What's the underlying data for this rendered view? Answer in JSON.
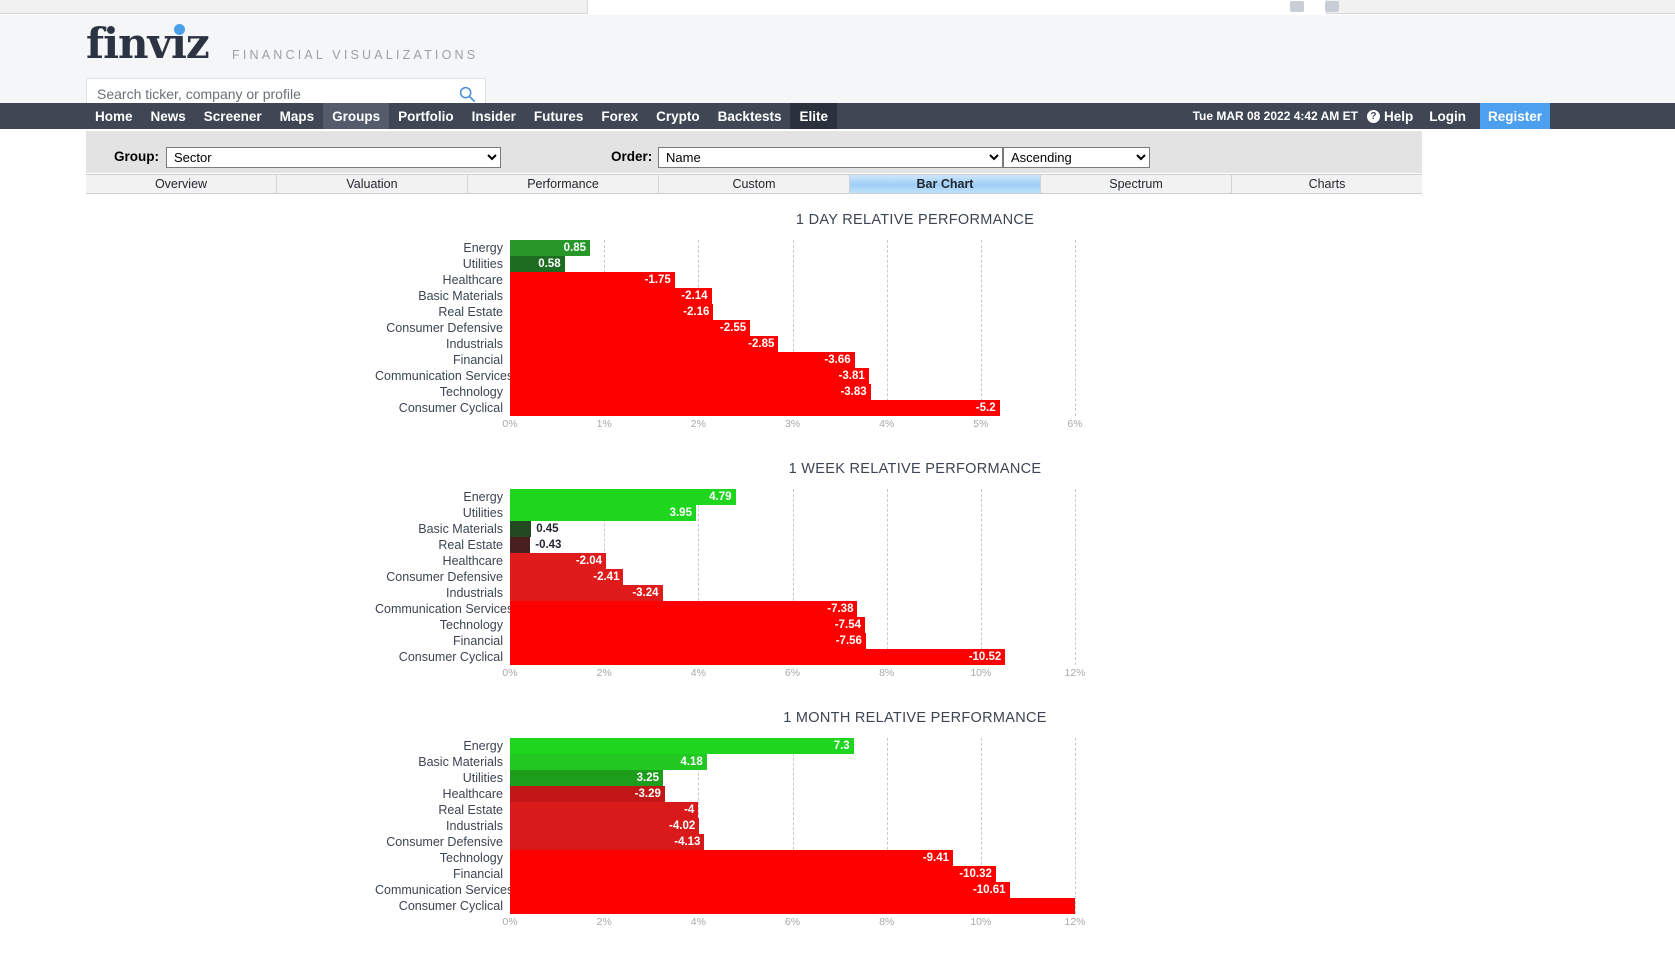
{
  "header": {
    "logo_text": "finviz",
    "tagline": "FINANCIAL VISUALIZATIONS",
    "search_placeholder": "Search ticker, company or profile",
    "search_value": "",
    "search_icon": "search-icon"
  },
  "nav": {
    "items": [
      {
        "label": "Home",
        "state": "normal"
      },
      {
        "label": "News",
        "state": "normal"
      },
      {
        "label": "Screener",
        "state": "normal"
      },
      {
        "label": "Maps",
        "state": "normal"
      },
      {
        "label": "Groups",
        "state": "active"
      },
      {
        "label": "Portfolio",
        "state": "normal"
      },
      {
        "label": "Insider",
        "state": "normal"
      },
      {
        "label": "Futures",
        "state": "normal"
      },
      {
        "label": "Forex",
        "state": "normal"
      },
      {
        "label": "Crypto",
        "state": "normal"
      },
      {
        "label": "Backtests",
        "state": "normal"
      },
      {
        "label": "Elite",
        "state": "elite"
      }
    ],
    "datetime": "Tue MAR 08 2022 4:42 AM ET",
    "help_icon": "question-mark-icon",
    "help_label": "Help",
    "login_label": "Login",
    "register_label": "Register",
    "register_color": "#4da0f0"
  },
  "controls": {
    "group_label": "Group:",
    "group_value": "Sector",
    "order_label": "Order:",
    "order_value": "Name",
    "direction_value": "Ascending"
  },
  "tabs": [
    {
      "label": "Overview",
      "active": false
    },
    {
      "label": "Valuation",
      "active": false
    },
    {
      "label": "Performance",
      "active": false
    },
    {
      "label": "Custom",
      "active": false
    },
    {
      "label": "Bar Chart",
      "active": true
    },
    {
      "label": "Spectrum",
      "active": false
    },
    {
      "label": "Charts",
      "active": false
    }
  ],
  "chart_data": [
    {
      "type": "bar",
      "orientation": "horizontal",
      "title": "1 DAY RELATIVE PERFORMANCE",
      "xlabel": "",
      "ylabel": "",
      "xlim": [
        0,
        6
      ],
      "ticks": [
        "0%",
        "1%",
        "2%",
        "3%",
        "4%",
        "5%",
        "6%"
      ],
      "grid": true,
      "categories": [
        "Energy",
        "Utilities",
        "Healthcare",
        "Basic Materials",
        "Real Estate",
        "Consumer Defensive",
        "Industrials",
        "Financial",
        "Communication Services",
        "Technology",
        "Consumer Cyclical"
      ],
      "values": [
        0.85,
        0.58,
        -1.75,
        -2.14,
        -2.16,
        -2.55,
        -2.85,
        -3.66,
        -3.81,
        -3.83,
        -5.2
      ],
      "labels": [
        "0.85",
        "0.58",
        "-1.75",
        "-2.14",
        "-2.16",
        "-2.55",
        "-2.85",
        "-3.66",
        "-3.81",
        "-3.83",
        "-5.2"
      ],
      "colors": [
        "#27972a",
        "#1e6b22",
        "#ff0000",
        "#ff0000",
        "#ff0000",
        "#ff0000",
        "#ff0000",
        "#ff0000",
        "#ff0000",
        "#ff0000",
        "#ff0000"
      ]
    },
    {
      "type": "bar",
      "orientation": "horizontal",
      "title": "1 WEEK RELATIVE PERFORMANCE",
      "xlabel": "",
      "ylabel": "",
      "xlim": [
        0,
        12
      ],
      "ticks": [
        "0%",
        "2%",
        "4%",
        "6%",
        "8%",
        "10%",
        "12%"
      ],
      "grid": true,
      "categories": [
        "Energy",
        "Utilities",
        "Basic Materials",
        "Real Estate",
        "Healthcare",
        "Consumer Defensive",
        "Industrials",
        "Communication Services",
        "Technology",
        "Financial",
        "Consumer Cyclical"
      ],
      "values": [
        4.79,
        3.95,
        0.45,
        -0.43,
        -2.04,
        -2.41,
        -3.24,
        -7.38,
        -7.54,
        -7.56,
        -10.52
      ],
      "labels": [
        "4.79",
        "3.95",
        "0.45",
        "-0.43",
        "-2.04",
        "-2.41",
        "-3.24",
        "-7.38",
        "-7.54",
        "-7.56",
        "-10.52"
      ],
      "colors": [
        "#1fd61f",
        "#1fd61f",
        "#224a22",
        "#4a1f1f",
        "#e01b1b",
        "#e01b1b",
        "#e01b1b",
        "#ff0000",
        "#ff0000",
        "#ff0000",
        "#ff0000"
      ]
    },
    {
      "type": "bar",
      "orientation": "horizontal",
      "title": "1 MONTH RELATIVE PERFORMANCE",
      "xlabel": "",
      "ylabel": "",
      "xlim": [
        0,
        12
      ],
      "ticks": [
        "0%",
        "2%",
        "4%",
        "6%",
        "8%",
        "10%",
        "12%"
      ],
      "grid": true,
      "categories": [
        "Energy",
        "Basic Materials",
        "Utilities",
        "Healthcare",
        "Real Estate",
        "Industrials",
        "Consumer Defensive",
        "Technology",
        "Financial",
        "Communication Services",
        "Consumer Cyclical"
      ],
      "values": [
        7.3,
        4.18,
        3.25,
        -3.29,
        -4,
        -4.02,
        -4.13,
        -9.41,
        -10.32,
        -10.61,
        -12.5
      ],
      "labels": [
        "7.3",
        "4.18",
        "3.25",
        "-3.29",
        "-4",
        "-4.02",
        "-4.13",
        "-9.41",
        "-10.32",
        "-10.61",
        ""
      ],
      "colors": [
        "#1fd61f",
        "#22c722",
        "#1c9e1c",
        "#c11717",
        "#d81a1a",
        "#d81a1a",
        "#d81a1a",
        "#ff0000",
        "#ff0000",
        "#ff0000",
        "#ff0000"
      ]
    }
  ]
}
